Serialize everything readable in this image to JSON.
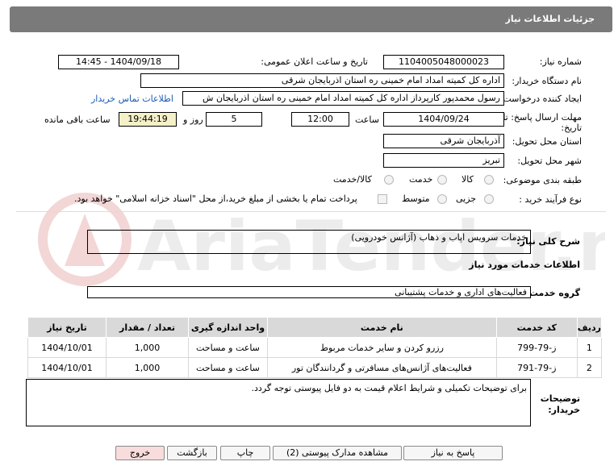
{
  "header": {
    "title": "جزئیات اطلاعات نیاز"
  },
  "fields": {
    "need_number_label": "شماره نیاز:",
    "need_number": "1104005048000023",
    "announce_label": "تاریخ و ساعت اعلان عمومی:",
    "announce_value": "1404/09/18 - 14:45",
    "buyer_org_label": "نام دستگاه خریدار:",
    "buyer_org": "اداره کل کمیته امداد امام خمینی  ره  استان اذربایجان شرقی",
    "requester_label": "ایجاد کننده درخواست:",
    "requester": "رسول محمدپور کارپرداز اداره کل کمیته امداد امام خمینی  ره  استان اذربایجان ش",
    "contact_link": "اطلاعات تماس خریدار",
    "deadline_label_1": "مهلت ارسال پاسخ: تا",
    "deadline_label_2": "تاریخ:",
    "deadline_date": "1404/09/24",
    "time_label": "ساعت",
    "deadline_time": "12:00",
    "days_value": "5",
    "days_label": "روز و",
    "remaining_time": "19:44:19",
    "remaining_label": "ساعت باقی مانده",
    "province_label": "استان محل تحویل:",
    "province": "آذربایجان شرقی",
    "city_label": "شهر محل تحویل:",
    "city": "تبریز",
    "category_label": "طبقه بندی موضوعی:",
    "category_options": [
      "کالا",
      "خدمت",
      "کالا/خدمت"
    ],
    "process_label": "نوع فرآیند خرید :",
    "process_options": [
      "جزیی",
      "متوسط"
    ],
    "payment_text": "پرداخت تمام یا بخشی از مبلغ خرید،از محل \"اسناد خزانه اسلامی\" خواهد بود."
  },
  "summary": {
    "label": "شرح کلی نیاز:",
    "value": "خدمات سرویس اپاب و ذهاب (آژانس خودرویی)"
  },
  "services_section": {
    "title": "اطلاعات خدمات مورد نیاز",
    "group_label": "گروه خدمت:",
    "group_value": "فعالیت‌های اداری و خدمات پشتیبانی"
  },
  "table": {
    "headers": [
      "ردیف",
      "کد خدمت",
      "نام خدمت",
      "واحد اندازه گیری",
      "تعداد / مقدار",
      "تاریخ نیاز"
    ],
    "rows": [
      [
        "1",
        "ز-79-799",
        "رزرو کردن و سایر خدمات مربوط",
        "ساعت و مساحت",
        "1,000",
        "1404/10/01"
      ],
      [
        "2",
        "ز-79-791",
        "فعالیت‌های آژانس‌های مسافرتی و گردانندگان تور",
        "ساعت و مساحت",
        "1,000",
        "1404/10/01"
      ]
    ]
  },
  "notes": {
    "label_1": "توضیحات",
    "label_2": "خریدار:",
    "value": "برای توضیحات تکمیلی و شرایط اعلام قیمت به دو فایل پیوستی توجه گردد."
  },
  "buttons": {
    "reply": "پاسخ به نیاز",
    "attachments": "مشاهده مدارک پیوستی (2)",
    "print": "چاپ",
    "back": "بازگشت",
    "exit": "خروج"
  },
  "watermark": {
    "text": "AriaTender.net"
  },
  "colors": {
    "header_bg": "#7a7a7a",
    "link": "#1a5bb5",
    "highlight": "#f4f0c8",
    "exit_btn": "#f9dcdc"
  }
}
